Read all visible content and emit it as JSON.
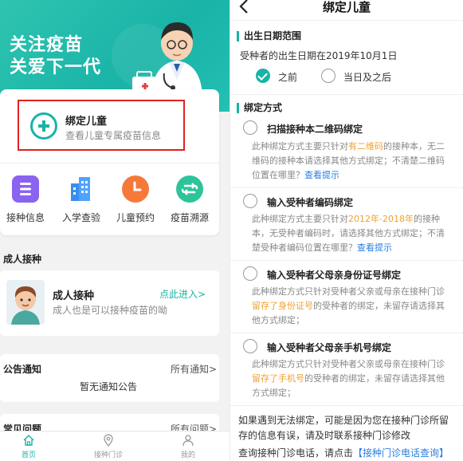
{
  "home": {
    "hero": {
      "line1": "关注疫苗",
      "line2": "关爱下一代"
    },
    "bind": {
      "title": "绑定儿童",
      "subtitle": "查看儿童专属疫苗信息"
    },
    "quick_actions": [
      {
        "label": "接种信息",
        "icon": "vaccine-info-icon",
        "color": "#8a63f0"
      },
      {
        "label": "入学查验",
        "icon": "school-building-icon",
        "color": "#3a8ef0"
      },
      {
        "label": "儿童预约",
        "icon": "clock-icon",
        "color": "#f57a3a"
      },
      {
        "label": "疫苗溯源",
        "icon": "trace-icon",
        "color": "#2ec49a"
      }
    ],
    "adult_section": "成人接种",
    "adult_card": {
      "title": "成人接种",
      "link": "点此进入>",
      "subtitle": "成人也是可以接种疫苗的呦"
    },
    "notice": {
      "title": "公告通知",
      "more": "所有通知>",
      "empty": "暂无通知公告"
    },
    "faq": {
      "title": "常见问题",
      "more": "所有问题>"
    },
    "tabs": [
      {
        "label": "首页",
        "icon": "home-icon",
        "active": true
      },
      {
        "label": "接种门诊",
        "icon": "location-pin-icon",
        "active": false
      },
      {
        "label": "我的",
        "icon": "user-icon",
        "active": false
      }
    ],
    "accent": "#19b3a7"
  },
  "bind_page": {
    "title": "绑定儿童",
    "birth_section": "出生日期范围",
    "birth_question": "受种者的出生日期在2019年10月1日",
    "birth_options": [
      {
        "label": "之前",
        "checked": true
      },
      {
        "label": "当日及之后",
        "checked": false
      }
    ],
    "method_section": "绑定方式",
    "methods": [
      {
        "title": "扫描接种本二维码绑定",
        "desc": [
          "此种绑定方式主要只针对",
          "有二维码",
          "的接种本，无二维码的接种本请选择其他方式绑定；不清楚二维码位置在哪里？",
          "查看提示"
        ]
      },
      {
        "title": "输入受种者编码绑定",
        "desc": [
          "此种绑定方式主要只针对",
          "2012年-2018年",
          "的接种本，无受种者编码时，请选择其他方式绑定；不清楚受种者编码位置在哪里？",
          "查看提示"
        ]
      },
      {
        "title": "输入受种者父母亲身份证号绑定",
        "desc": [
          "此种绑定方式只针对受种者父亲或母亲在接种门诊",
          "留存了身份证号",
          "的受种者的绑定，未留存请选择其他方式绑定；",
          ""
        ]
      },
      {
        "title": "输入受种者父母亲手机号绑定",
        "desc": [
          "此种绑定方式只针对受种者父亲或母亲在接种门诊",
          "留存了手机号",
          "的受种者的绑定，未留存请选择其他方式绑定；",
          ""
        ]
      }
    ],
    "footer_note": "如果遇到无法绑定，可能是因为您在接种门诊所留存的信息有误，请及时联系接种门诊修改",
    "footer_query": "查询接种门诊电话，请点击",
    "footer_link": "【接种门诊电话查询】"
  }
}
